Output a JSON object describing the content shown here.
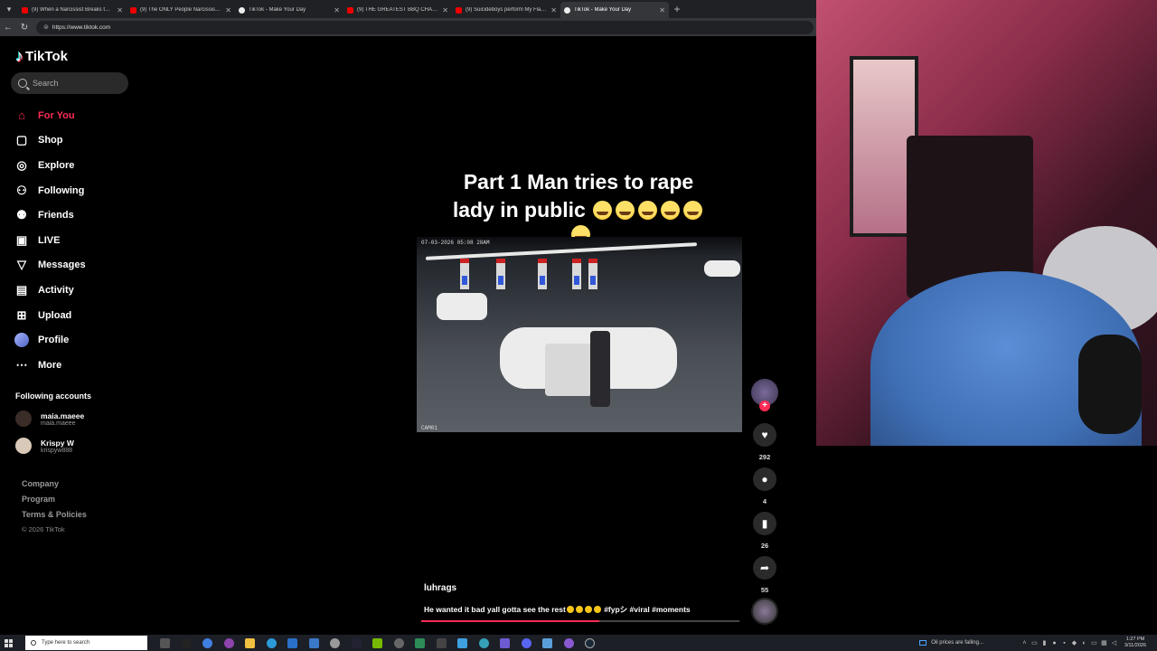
{
  "browser": {
    "tabs": [
      {
        "title": "(9) When a Narcissist Breaks the S",
        "icon": "youtube",
        "active": false
      },
      {
        "title": "(9) The ONLY People Narcissists D",
        "icon": "youtube",
        "active": false
      },
      {
        "title": "TikTok - Make Your Day",
        "icon": "tiktok",
        "active": false
      },
      {
        "title": "(9) THE GREATEST BBQ CHALLENG",
        "icon": "youtube",
        "active": false
      },
      {
        "title": "(9) Suicideboys perform My Flaws",
        "icon": "youtube",
        "active": false
      },
      {
        "title": "TikTok - Make Your Day",
        "icon": "tiktok",
        "active": true
      }
    ],
    "url": "https://www.tiktok.com"
  },
  "sidebar": {
    "logo": "TikTok",
    "search_placeholder": "Search",
    "menu": [
      {
        "label": "For You",
        "icon": "home-icon",
        "glyph": "⌂",
        "active": true
      },
      {
        "label": "Shop",
        "icon": "shop-icon",
        "glyph": "▢",
        "active": false
      },
      {
        "label": "Explore",
        "icon": "compass-icon",
        "glyph": "◎",
        "active": false
      },
      {
        "label": "Following",
        "icon": "following-icon",
        "glyph": "⚇",
        "active": false
      },
      {
        "label": "Friends",
        "icon": "friends-icon",
        "glyph": "⚉",
        "active": false
      },
      {
        "label": "LIVE",
        "icon": "live-icon",
        "glyph": "▣",
        "active": false
      },
      {
        "label": "Messages",
        "icon": "messages-icon",
        "glyph": "▽",
        "active": false
      },
      {
        "label": "Activity",
        "icon": "activity-icon",
        "glyph": "▤",
        "active": false
      },
      {
        "label": "Upload",
        "icon": "upload-icon",
        "glyph": "⊞",
        "active": false
      },
      {
        "label": "Profile",
        "icon": "profile-icon",
        "glyph": "",
        "active": false
      },
      {
        "label": "More",
        "icon": "more-icon",
        "glyph": "⋯",
        "active": false
      }
    ],
    "following_title": "Following accounts",
    "following": [
      {
        "name": "maia.maeee",
        "handle": "maia.maeee"
      },
      {
        "name": "Krispy W",
        "handle": "krispyw888"
      }
    ],
    "footer": [
      "Company",
      "Program",
      "Terms & Policies"
    ],
    "copyright": "© 2026 TikTok"
  },
  "video": {
    "overlay_text_line1": "Part 1 Man tries to rape",
    "overlay_text_line2": "lady in public",
    "timestamp": "07-03-2026 05:08 28AM",
    "camera_label": "CAM01",
    "author": "luhrags",
    "description_pre": "He wanted it bad yall gotta see the rest",
    "description_tags": "#fypシ #viral #moments",
    "progress": 0.56
  },
  "actions": {
    "likes": "292",
    "comments": "4",
    "saves": "26",
    "shares": "55"
  },
  "taskbar": {
    "search_placeholder": "Type here to search",
    "news": "Oil prices are falling...",
    "time": "1:27 PM",
    "date": "3/11/2026"
  },
  "colors": {
    "accent": "#fe2c55",
    "background": "#000000"
  }
}
